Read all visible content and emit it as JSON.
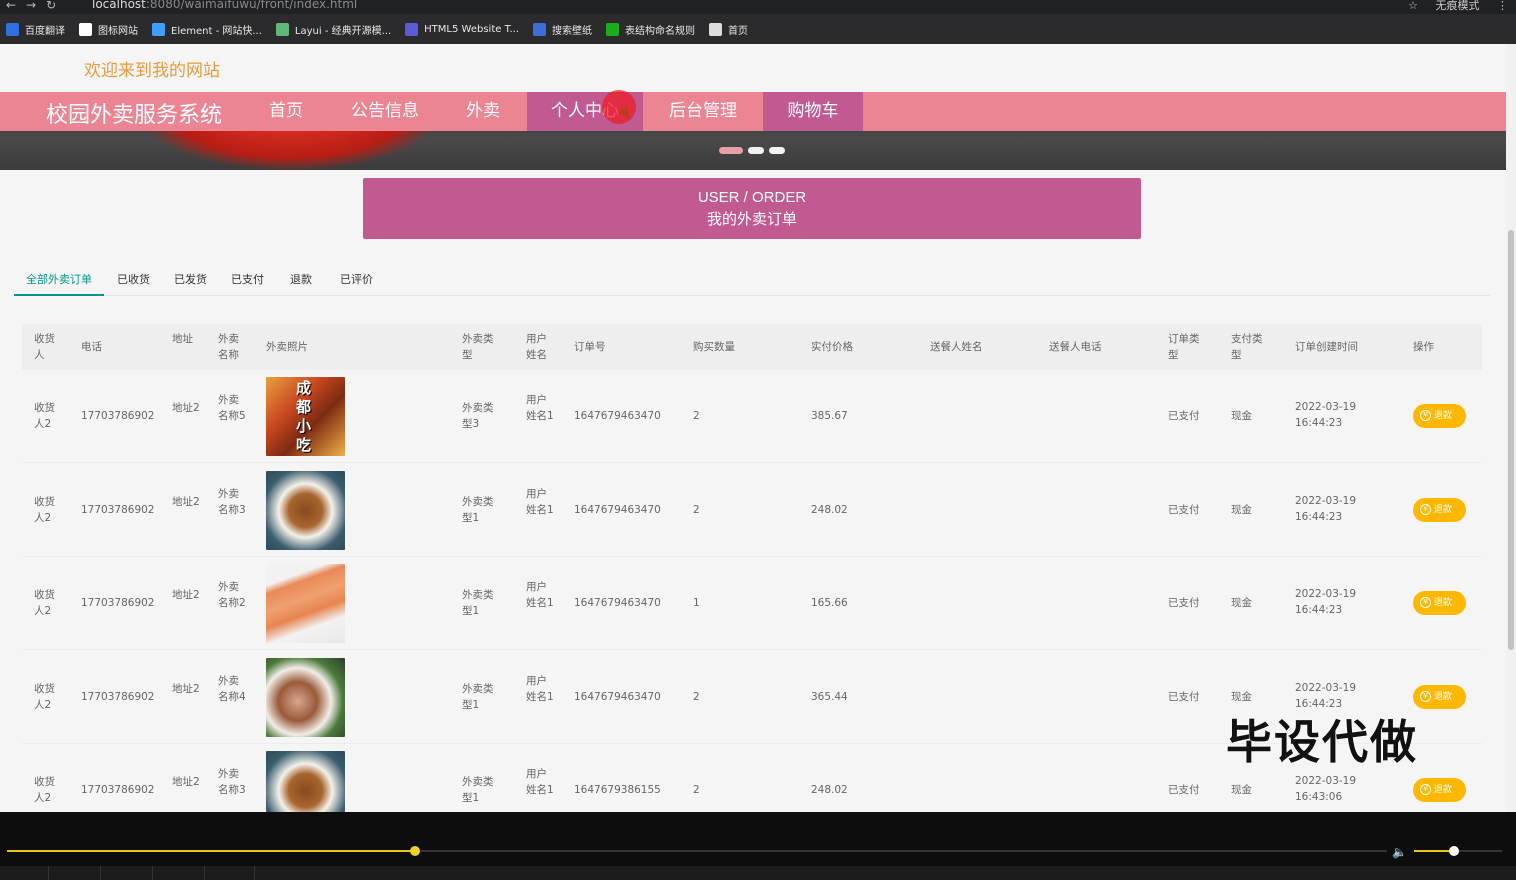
{
  "browser": {
    "url_host": "localhost",
    "url_path": ":8080/waimaifuwu/front/index.html",
    "profile_label": "无痕模式",
    "bookmarks": [
      {
        "label": "百度翻译",
        "color": "#2f6fe0"
      },
      {
        "label": "图标网站",
        "color": "#ffffff"
      },
      {
        "label": "Element - 网站快...",
        "color": "#409eff"
      },
      {
        "label": "Layui - 经典开源模...",
        "color": "#5fb878"
      },
      {
        "label": "HTML5 Website T...",
        "color": "#5b5bd6"
      },
      {
        "label": "搜索壁纸",
        "color": "#3a6fd8"
      },
      {
        "label": "表结构命名规则",
        "color": "#1aad19"
      },
      {
        "label": "首页",
        "color": "#dddddd"
      }
    ]
  },
  "site": {
    "welcome": "欢迎来到我的网站",
    "brand": "校园外卖服务系统",
    "nav": [
      "首页",
      "公告信息",
      "外卖",
      "个人中心",
      "后台管理",
      "购物车"
    ],
    "active_nav": "个人中心",
    "nav_color": "#ec8593",
    "accent_color": "#c25a92"
  },
  "order_banner": {
    "en": "USER / ORDER",
    "cn": "我的外卖订单"
  },
  "tabs": [
    "全部外卖订单",
    "已收货",
    "已发货",
    "已支付",
    "退款",
    "已评价"
  ],
  "table": {
    "headers": [
      "收货人",
      "电话",
      "地址",
      "外卖名称",
      "外卖照片",
      "外卖类型",
      "用户姓名",
      "订单号",
      "购买数量",
      "实付价格",
      "送餐人姓名",
      "送餐人电话",
      "订单类型",
      "支付类型",
      "订单创建时间",
      "操作"
    ],
    "rows": [
      {
        "receiver": "收货人2",
        "phone": "17703786902",
        "address": "地址2",
        "food_name": "外卖名称5",
        "photo": "food-photo-chengdu-snacks",
        "food_type": "外卖类型3",
        "user_name": "用户姓名1",
        "order_no": "1647679463470",
        "qty": "2",
        "price": "385.67",
        "courier_name": "",
        "courier_phone": "",
        "order_type": "已支付",
        "pay_type": "现金",
        "created": "2022-03-19 16:44:23",
        "action": "退款"
      },
      {
        "receiver": "收货人2",
        "phone": "17703786902",
        "address": "地址2",
        "food_name": "外卖名称3",
        "photo": "food-photo-noodle-bowl",
        "food_type": "外卖类型1",
        "user_name": "用户姓名1",
        "order_no": "1647679463470",
        "qty": "2",
        "price": "248.02",
        "courier_name": "",
        "courier_phone": "",
        "order_type": "已支付",
        "pay_type": "现金",
        "created": "2022-03-19 16:44:23",
        "action": "退款"
      },
      {
        "receiver": "收货人2",
        "phone": "17703786902",
        "address": "地址2",
        "food_name": "外卖名称2",
        "photo": "food-photo-sushi",
        "food_type": "外卖类型1",
        "user_name": "用户姓名1",
        "order_no": "1647679463470",
        "qty": "1",
        "price": "165.66",
        "courier_name": "",
        "courier_phone": "",
        "order_type": "已支付",
        "pay_type": "现金",
        "created": "2022-03-19 16:44:23",
        "action": "退款"
      },
      {
        "receiver": "收货人2",
        "phone": "17703786902",
        "address": "地址2",
        "food_name": "外卖名称4",
        "photo": "food-photo-seafood-plate",
        "food_type": "外卖类型1",
        "user_name": "用户姓名1",
        "order_no": "1647679463470",
        "qty": "2",
        "price": "365.44",
        "courier_name": "",
        "courier_phone": "",
        "order_type": "已支付",
        "pay_type": "现金",
        "created": "2022-03-19 16:44:23",
        "action": "退款"
      },
      {
        "receiver": "收货人2",
        "phone": "17703786902",
        "address": "地址2",
        "food_name": "外卖名称3",
        "photo": "food-photo-noodle-bowl",
        "food_type": "外卖类型1",
        "user_name": "用户姓名1",
        "order_no": "1647679386155",
        "qty": "2",
        "price": "248.02",
        "courier_name": "",
        "courier_phone": "",
        "order_type": "已支付",
        "pay_type": "现金",
        "created": "2022-03-19 16:43:06",
        "action": "退款"
      }
    ]
  },
  "photo1_text": "成都小吃",
  "watermark": "毕设代做",
  "player": {
    "progress": 0.296,
    "volume": 0.45
  }
}
